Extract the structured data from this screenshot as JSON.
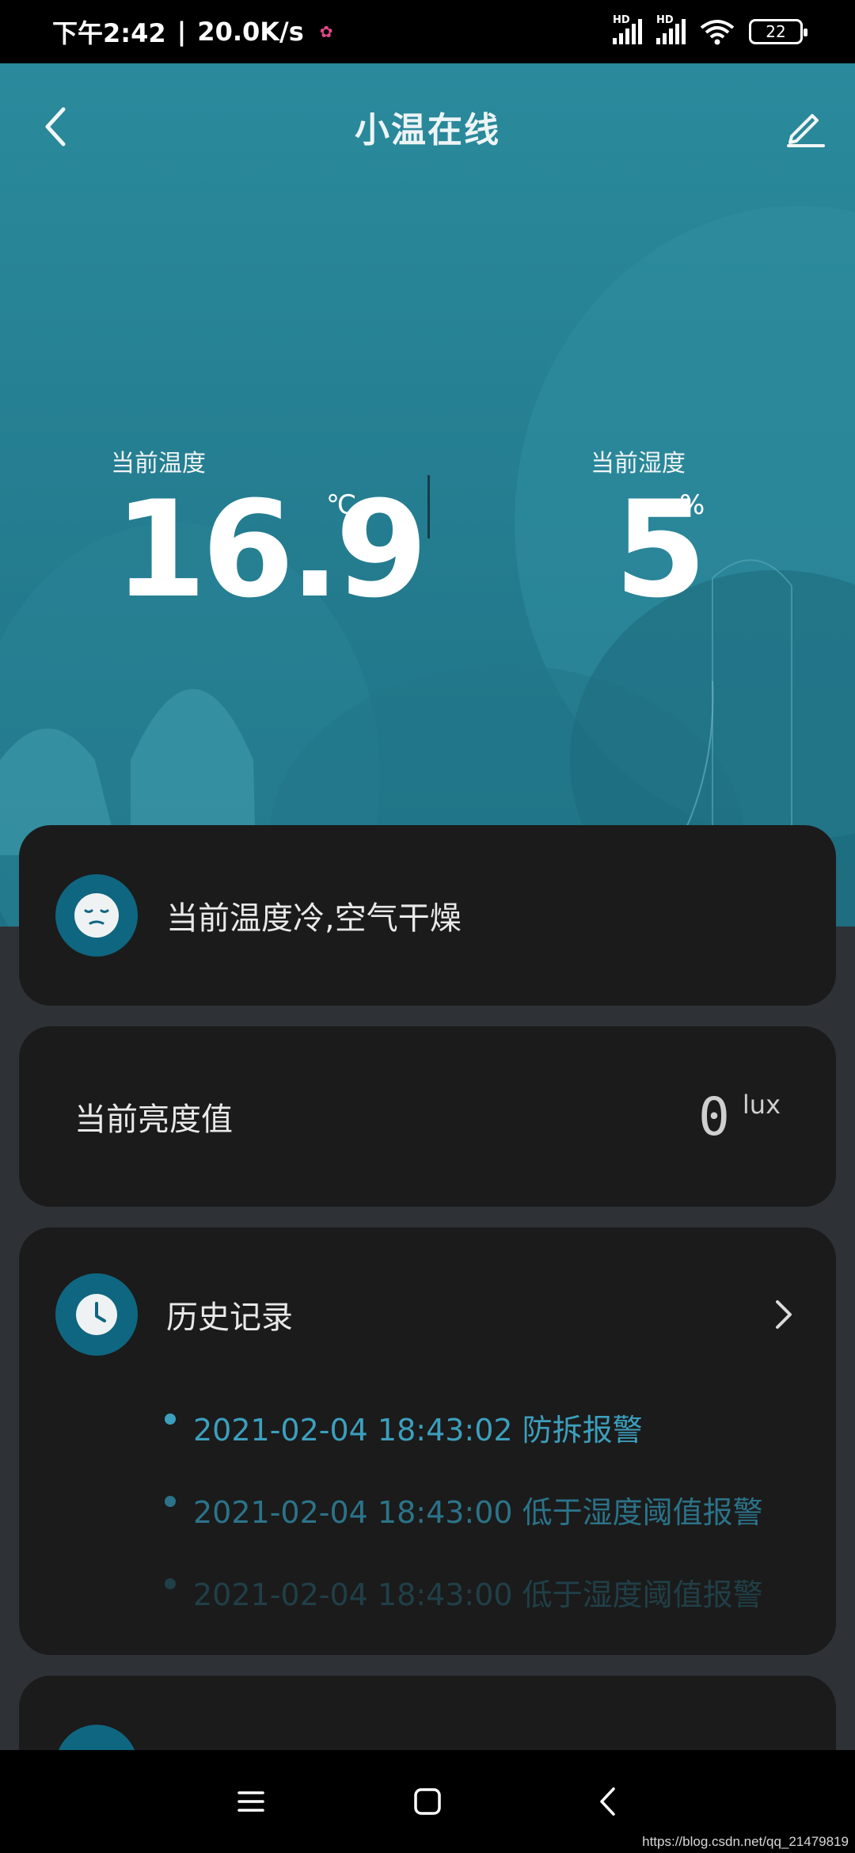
{
  "status_bar": {
    "time": "下午2:42",
    "separator": "|",
    "net_speed": "20.0K/s",
    "signal_1_label": "HD",
    "signal_2_label": "HD",
    "battery": "22"
  },
  "header": {
    "title": "小温在线",
    "back_icon": "chevron-left-icon",
    "edit_icon": "pencil-icon"
  },
  "metrics": {
    "temperature": {
      "label": "当前温度",
      "value": "16.9",
      "unit": "℃"
    },
    "humidity": {
      "label": "当前湿度",
      "value": "5",
      "unit": "%"
    }
  },
  "comfort_card": {
    "icon": "face-icon",
    "text": "当前温度冷,空气干燥"
  },
  "brightness_card": {
    "label": "当前亮度值",
    "value": "0",
    "unit": "lux"
  },
  "history_card": {
    "icon": "clock-icon",
    "title": "历史记录",
    "items": [
      {
        "text": "2021-02-04 18:43:02 防拆报警"
      },
      {
        "text": "2021-02-04 18:43:00 低于湿度阈值报警"
      },
      {
        "text": "2021-02-04 18:43:00 低于湿度阈值报警"
      }
    ]
  },
  "watermark": "https://blog.csdn.net/qq_21479819",
  "colors": {
    "hero_top": "#2a8a9c",
    "hero_bottom": "#1f7185",
    "accent": "#0f6680",
    "card_bg": "#1b1b1b",
    "history_text": "#3c9fbd"
  }
}
